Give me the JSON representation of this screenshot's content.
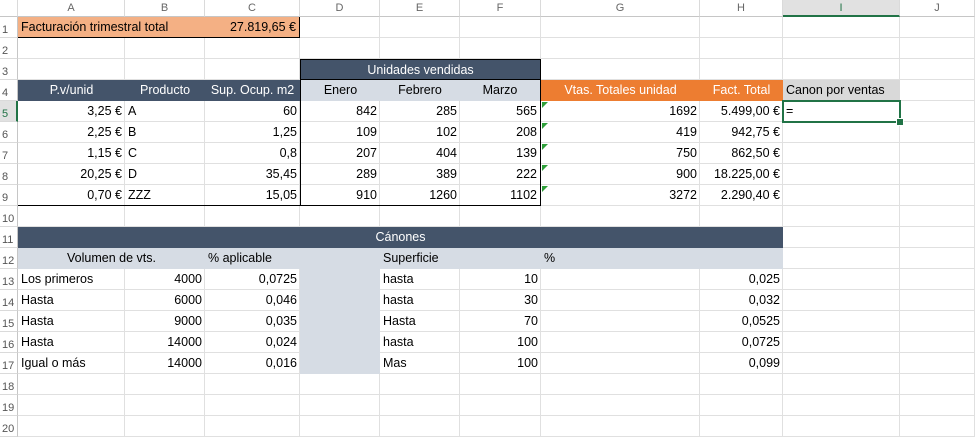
{
  "columns": [
    "A",
    "B",
    "C",
    "D",
    "E",
    "F",
    "G",
    "H",
    "I",
    "J"
  ],
  "rows": [
    "1",
    "2",
    "3",
    "4",
    "5",
    "6",
    "7",
    "8",
    "9",
    "10",
    "11",
    "12",
    "13",
    "14",
    "15",
    "16",
    "17",
    "18",
    "19",
    "20"
  ],
  "active_cell": "I5",
  "facturacion": {
    "label": "Facturación trimestral total",
    "value": "27.819,65 €"
  },
  "unidades_title": "Unidades vendidas",
  "headers": {
    "pv": "P.v/unid",
    "producto": "Producto",
    "sup": "Sup. Ocup. m2",
    "enero": "Enero",
    "febrero": "Febrero",
    "marzo": "Marzo",
    "vtas": "Vtas. Totales unidad",
    "fact": "Fact. Total",
    "canon": "Canon por ventas"
  },
  "products": [
    {
      "pv": "3,25 €",
      "producto": "A",
      "sup": "60",
      "enero": "842",
      "febrero": "285",
      "marzo": "565",
      "vtas": "1692",
      "fact": "5.499,00 €"
    },
    {
      "pv": "2,25 €",
      "producto": "B",
      "sup": "1,25",
      "enero": "109",
      "febrero": "102",
      "marzo": "208",
      "vtas": "419",
      "fact": "942,75 €"
    },
    {
      "pv": "1,15 €",
      "producto": "C",
      "sup": "0,8",
      "enero": "207",
      "febrero": "404",
      "marzo": "139",
      "vtas": "750",
      "fact": "862,50 €"
    },
    {
      "pv": "20,25 €",
      "producto": "D",
      "sup": "35,45",
      "enero": "289",
      "febrero": "389",
      "marzo": "222",
      "vtas": "900",
      "fact": "18.225,00 €"
    },
    {
      "pv": "0,70 €",
      "producto": "ZZZ",
      "sup": "15,05",
      "enero": "910",
      "febrero": "1260",
      "marzo": "1102",
      "vtas": "3272",
      "fact": "2.290,40 €"
    }
  ],
  "formula_in_cell": "=",
  "canones": {
    "title": "Cánones",
    "vol_header": "Volumen de vts.",
    "pct_header": "% aplicable",
    "sup_header": "Superficie",
    "sup_pct_header": "%",
    "vol_rows": [
      {
        "label": "Los primeros",
        "value": "4000",
        "pct": "0,0725"
      },
      {
        "label": "Hasta",
        "value": "6000",
        "pct": "0,046"
      },
      {
        "label": "Hasta",
        "value": "9000",
        "pct": "0,035"
      },
      {
        "label": "Hasta",
        "value": "14000",
        "pct": "0,024"
      },
      {
        "label": "Igual o más",
        "value": "14000",
        "pct": "0,016"
      }
    ],
    "sup_rows": [
      {
        "label": "hasta",
        "value": "10",
        "pct": "0,025"
      },
      {
        "label": "hasta",
        "value": "30",
        "pct": "0,032"
      },
      {
        "label": "Hasta",
        "value": "70",
        "pct": "0,0525"
      },
      {
        "label": "hasta",
        "value": "100",
        "pct": "0,0725"
      },
      {
        "label": "Mas",
        "value": "100",
        "pct": "0,099"
      }
    ]
  },
  "colors": {
    "dark_header": "#44546a",
    "orange_header": "#ed7d31",
    "light_orange": "#f4b084",
    "light_blue": "#d6dce4",
    "selection": "#217346"
  }
}
